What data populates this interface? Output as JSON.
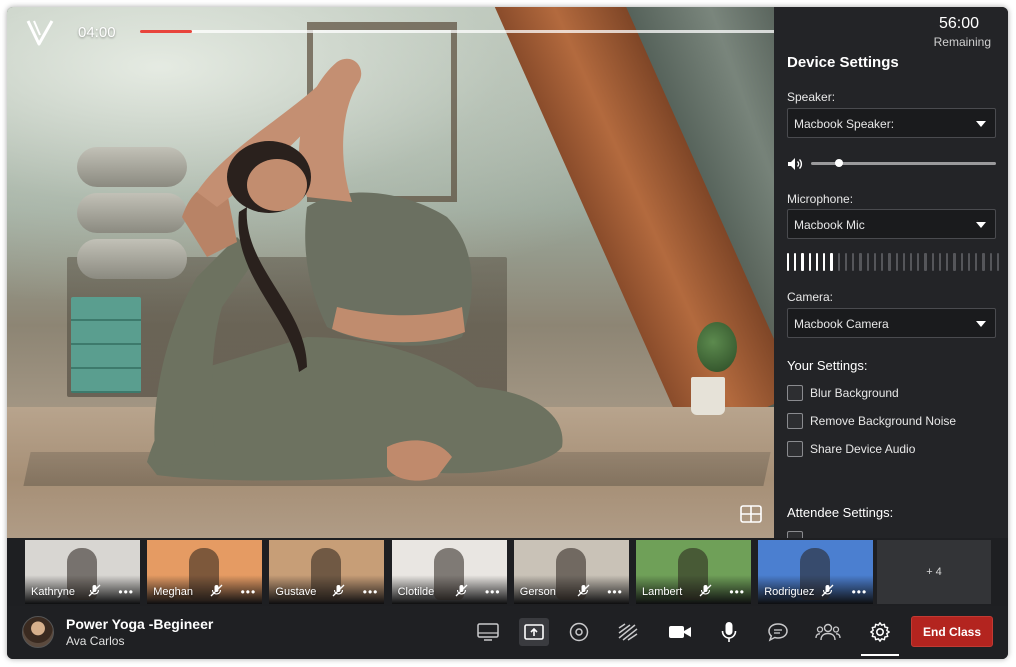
{
  "player": {
    "elapsed": "04:00",
    "remaining_time": "56:00",
    "remaining_label": "Remaining",
    "progress_percent": 6.7
  },
  "device_settings": {
    "title": "Device Settings",
    "speaker": {
      "label": "Speaker:",
      "value": "Macbook Speaker:"
    },
    "speaker_volume_percent": 15,
    "microphone": {
      "label": "Microphone:",
      "value": "Macbook Mic"
    },
    "mic_level_bars_active": 7,
    "mic_level_bars_total": 30,
    "camera": {
      "label": "Camera:",
      "value": "Macbook Camera"
    },
    "your_settings": {
      "title": "Your Settings:",
      "options": [
        {
          "label": "Blur Background",
          "checked": false
        },
        {
          "label": "Remove Background Noise",
          "checked": false
        },
        {
          "label": "Share Device Audio",
          "checked": false
        }
      ]
    },
    "attendee_settings": {
      "title": "Attendee Settings:"
    }
  },
  "attendees": [
    {
      "name": "Kathryne",
      "bg": "#d8d6d2"
    },
    {
      "name": "Meghan",
      "bg": "#e59b63"
    },
    {
      "name": "Gustave",
      "bg": "#c79e77"
    },
    {
      "name": "Clotilde",
      "bg": "#e9e6e2"
    },
    {
      "name": "Gerson",
      "bg": "#c9c2b7"
    },
    {
      "name": "Lambert",
      "bg": "#6fa058"
    },
    {
      "name": "Rodriguez",
      "bg": "#4b7fd0"
    }
  ],
  "attendees_overflow": "+ 4",
  "class_info": {
    "title": "Power Yoga -Begineer",
    "host": "Ava Carlos"
  },
  "controls": {
    "end_class_label": "End Class"
  },
  "colors": {
    "accent_red": "#b3241f",
    "progress_red": "#e8453c",
    "panel_bg": "#232427"
  }
}
